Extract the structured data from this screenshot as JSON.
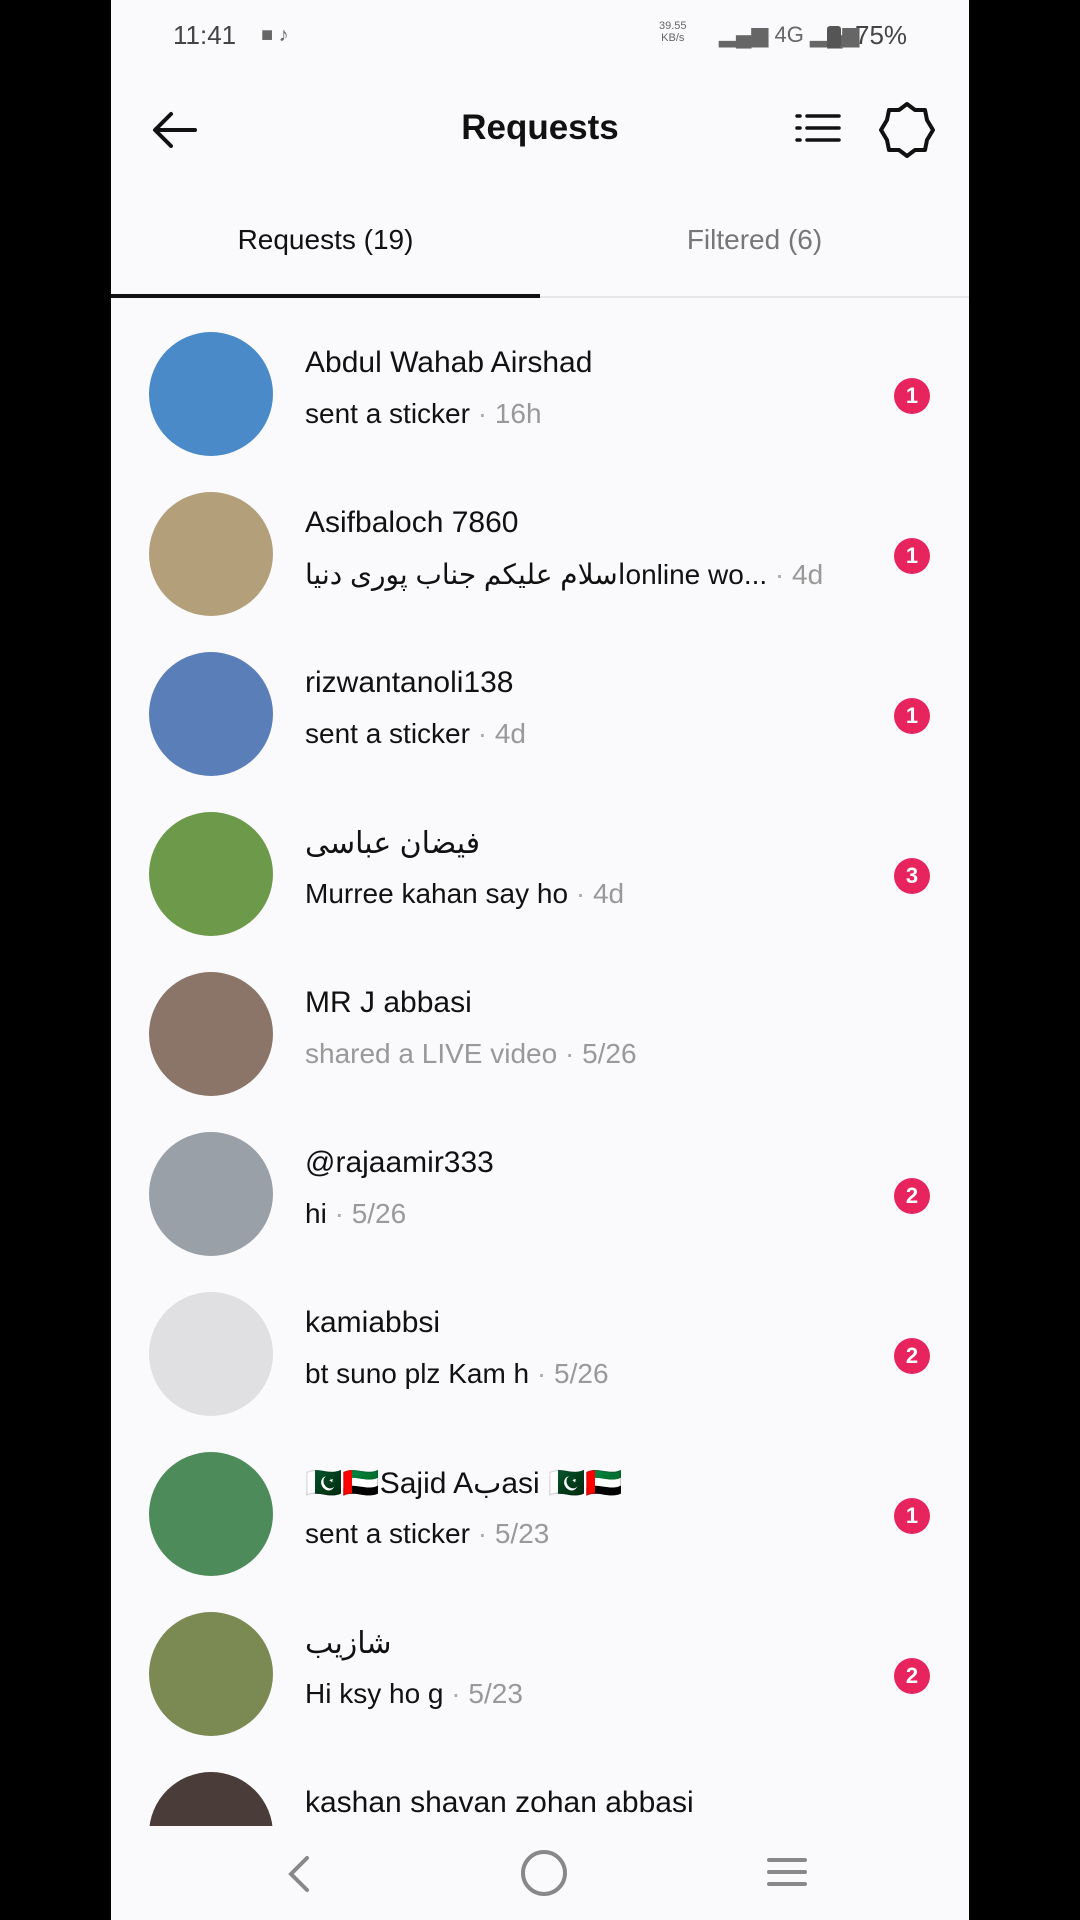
{
  "status_bar": {
    "time": "11:41",
    "net_speed_top": "39.55",
    "net_speed_bottom": "KB/s",
    "network": "4G",
    "battery": "75%"
  },
  "header": {
    "title": "Requests",
    "back_icon": "arrow-left-icon",
    "list_icon": "list-icon",
    "settings_icon": "gear-icon"
  },
  "tabs": [
    {
      "label": "Requests (19)",
      "active": true
    },
    {
      "label": "Filtered (6)",
      "active": false
    }
  ],
  "requests": [
    {
      "name": "Abdul Wahab Airshad",
      "message": "sent a sticker",
      "time": "16h",
      "badge": "1",
      "muted": false,
      "avatar_color": "#4a8ac9"
    },
    {
      "name": "Asifbaloch 7860",
      "message": "اسلام علیکم جناب پوری دنیاonline  wo...",
      "time": "4d",
      "badge": "1",
      "muted": false,
      "avatar_color": "#b3a07a"
    },
    {
      "name": "rizwantanoli138",
      "message": "sent a sticker",
      "time": "4d",
      "badge": "1",
      "muted": false,
      "avatar_color": "#5a7fb8"
    },
    {
      "name": "فیضان عباسی",
      "message": "Murree kahan say ho",
      "time": "4d",
      "badge": "3",
      "muted": false,
      "avatar_color": "#6c9a4a"
    },
    {
      "name": "MR J abbasi",
      "message": "shared a LIVE video",
      "time": "5/26",
      "badge": "",
      "muted": true,
      "avatar_color": "#8a7568"
    },
    {
      "name": "@rajaamir333",
      "message": "hi",
      "time": "5/26",
      "badge": "2",
      "muted": false,
      "avatar_color": "#9aa0a8"
    },
    {
      "name": "kamiabbsi",
      "message": "bt suno plz Kam h",
      "time": "5/26",
      "badge": "2",
      "muted": false,
      "avatar_color": "#e0e0e3"
    },
    {
      "name": "🇵🇰🇦🇪Sajid Aبasi 🇵🇰🇦🇪",
      "message": "sent a sticker",
      "time": "5/23",
      "badge": "1",
      "muted": false,
      "avatar_color": "#4e8b5a"
    },
    {
      "name": "شازیب",
      "message": "Hi ksy ho g",
      "time": "5/23",
      "badge": "2",
      "muted": false,
      "avatar_color": "#7a8a52"
    },
    {
      "name": "kashan shavan zohan abbasi",
      "message": "",
      "time": "",
      "badge": "",
      "muted": false,
      "avatar_color": "#4a3c38"
    }
  ],
  "nav_bar": {
    "back_icon": "nav-back-icon",
    "home_icon": "nav-home-icon",
    "recents_icon": "nav-recents-icon"
  }
}
